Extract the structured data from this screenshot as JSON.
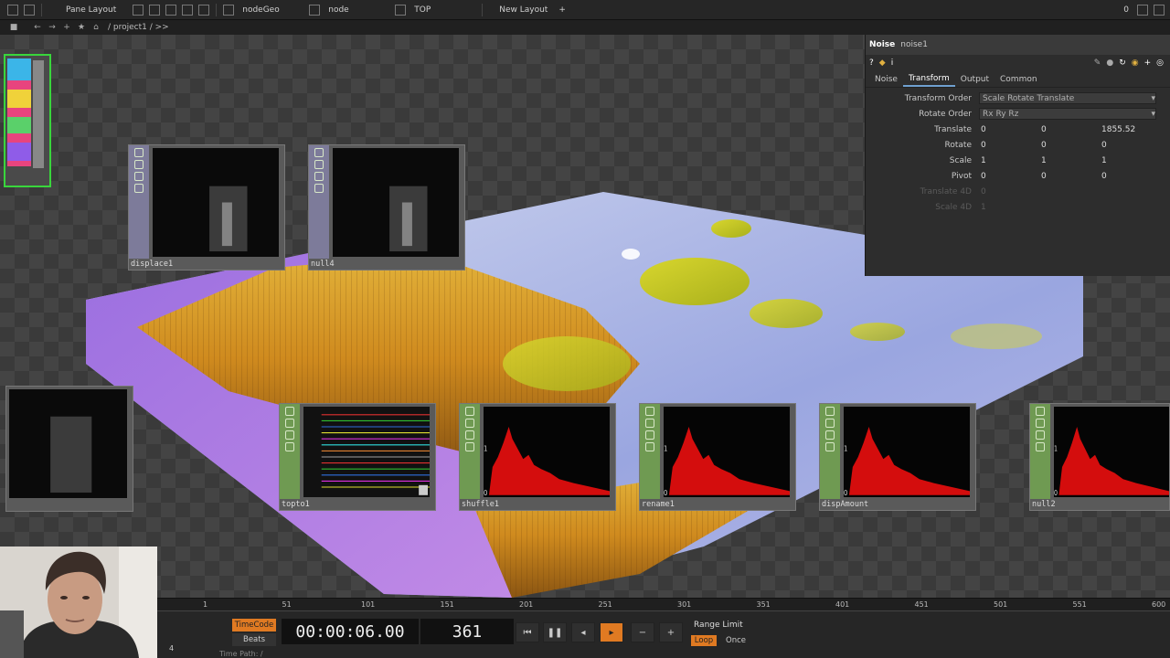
{
  "topbar": {
    "pane_layout": "Pane Layout",
    "tabs": [
      "nodeGeo",
      "node",
      "TOP",
      "New Layout"
    ],
    "add_symbol": "+",
    "right_value": "0"
  },
  "pathbar": {
    "path": "/ project1 / >>"
  },
  "params": {
    "op_type": "Noise",
    "op_name": "noise1",
    "info_icon": "i",
    "tabs": [
      "Noise",
      "Transform",
      "Output",
      "Common"
    ],
    "active_tab": "Transform",
    "transform_order": {
      "label": "Transform Order",
      "value": "Scale Rotate Translate"
    },
    "rotate_order": {
      "label": "Rotate Order",
      "value": "Rx Ry Rz"
    },
    "rows": [
      {
        "label": "Translate",
        "v1": "0",
        "v2": "0",
        "v3": "1855.52"
      },
      {
        "label": "Rotate",
        "v1": "0",
        "v2": "0",
        "v3": "0"
      },
      {
        "label": "Scale",
        "v1": "1",
        "v2": "1",
        "v3": "1"
      },
      {
        "label": "Pivot",
        "v1": "0",
        "v2": "0",
        "v3": "0"
      }
    ],
    "translate4d": {
      "label": "Translate 4D",
      "value": "0"
    },
    "scale4d": {
      "label": "Scale 4D",
      "value": "1"
    }
  },
  "operators": [
    {
      "name": "displace1"
    },
    {
      "name": "null4"
    },
    {
      "name": "topto1"
    },
    {
      "name": "shuffle1"
    },
    {
      "name": "rename1"
    },
    {
      "name": "dispAmount"
    },
    {
      "name": "null2"
    }
  ],
  "chop_axis": {
    "top": "1",
    "zero": "0"
  },
  "timeline": {
    "ruler_ticks": [
      "1",
      "51",
      "101",
      "151",
      "201",
      "251",
      "301",
      "351",
      "401",
      "451",
      "501",
      "551",
      "600"
    ],
    "timecode_label": "TimeCode",
    "beats_label": "Beats",
    "timecode": "00:00:06.00",
    "frame": "361",
    "range_limit": "Range Limit",
    "loop": "Loop",
    "once": "Once",
    "minus": "−",
    "plus": "+",
    "time_path": "Time Path: /",
    "small_number": "4"
  },
  "colors": {
    "accent": "#e07a22",
    "selection": "#39d63c",
    "chop_red": "#d40d0d"
  }
}
